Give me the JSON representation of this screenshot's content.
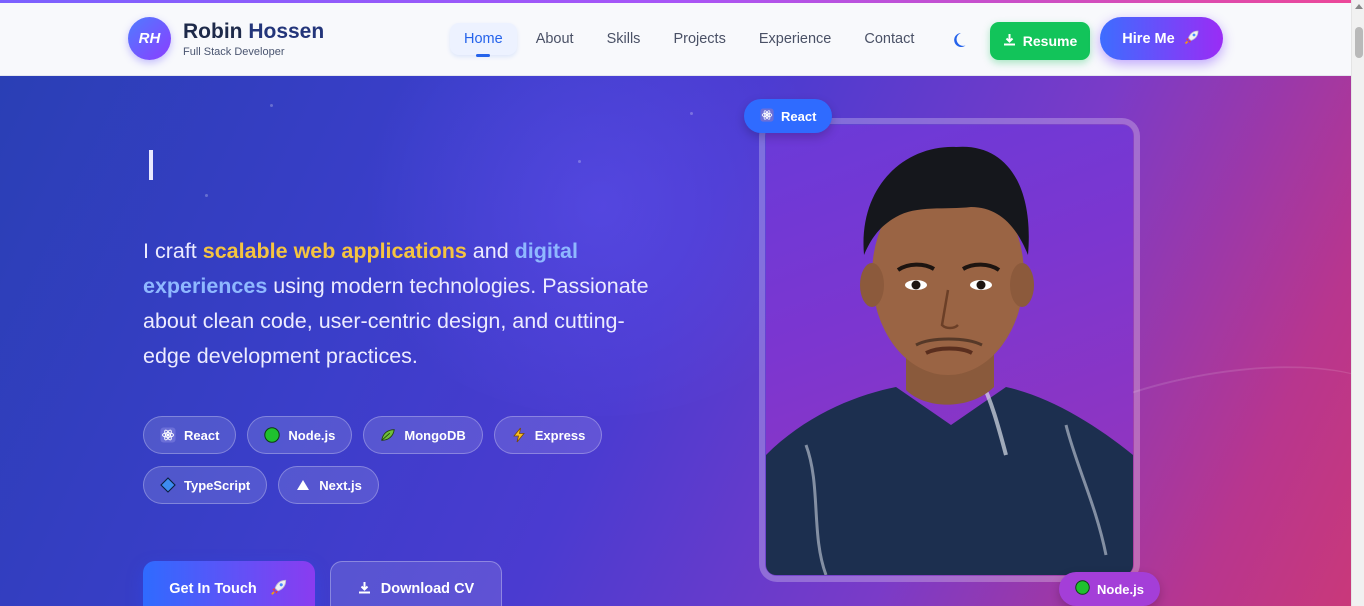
{
  "brand": {
    "initials": "RH",
    "first_name": "Robin",
    "last_name": "Hossen",
    "subtitle": "Full Stack Developer"
  },
  "nav": {
    "links": [
      {
        "label": "Home",
        "active": true
      },
      {
        "label": "About",
        "active": false
      },
      {
        "label": "Skills",
        "active": false
      },
      {
        "label": "Projects",
        "active": false
      },
      {
        "label": "Experience",
        "active": false
      },
      {
        "label": "Contact",
        "active": false
      }
    ],
    "theme_icon": "moon-icon",
    "resume_label": "Resume",
    "hire_label": "Hire Me"
  },
  "hero": {
    "typing_text": "",
    "intro": {
      "t1": "I craft ",
      "h1": "scalable web applications",
      "t2": " and ",
      "h2": "digital experiences",
      "t3": " using modern technologies. Passionate about clean code, user-centric design, and cutting-edge development practices."
    },
    "tech_chips": [
      {
        "label": "React",
        "icon": "react-icon"
      },
      {
        "label": "Node.js",
        "icon": "nodejs-icon"
      },
      {
        "label": "MongoDB",
        "icon": "mongodb-leaf-icon"
      },
      {
        "label": "Express",
        "icon": "lightning-icon"
      },
      {
        "label": "TypeScript",
        "icon": "diamond-icon"
      },
      {
        "label": "Next.js",
        "icon": "triangle-icon"
      }
    ],
    "cta_primary": "Get In Touch",
    "cta_secondary": "Download CV",
    "floating_badges": {
      "top": "React",
      "bottom": "Node.js"
    }
  },
  "colors": {
    "accent_blue": "#2563eb",
    "resume_green": "#12c45a",
    "highlight_yellow": "#f5c440",
    "highlight_blue": "#8fb8ff"
  }
}
